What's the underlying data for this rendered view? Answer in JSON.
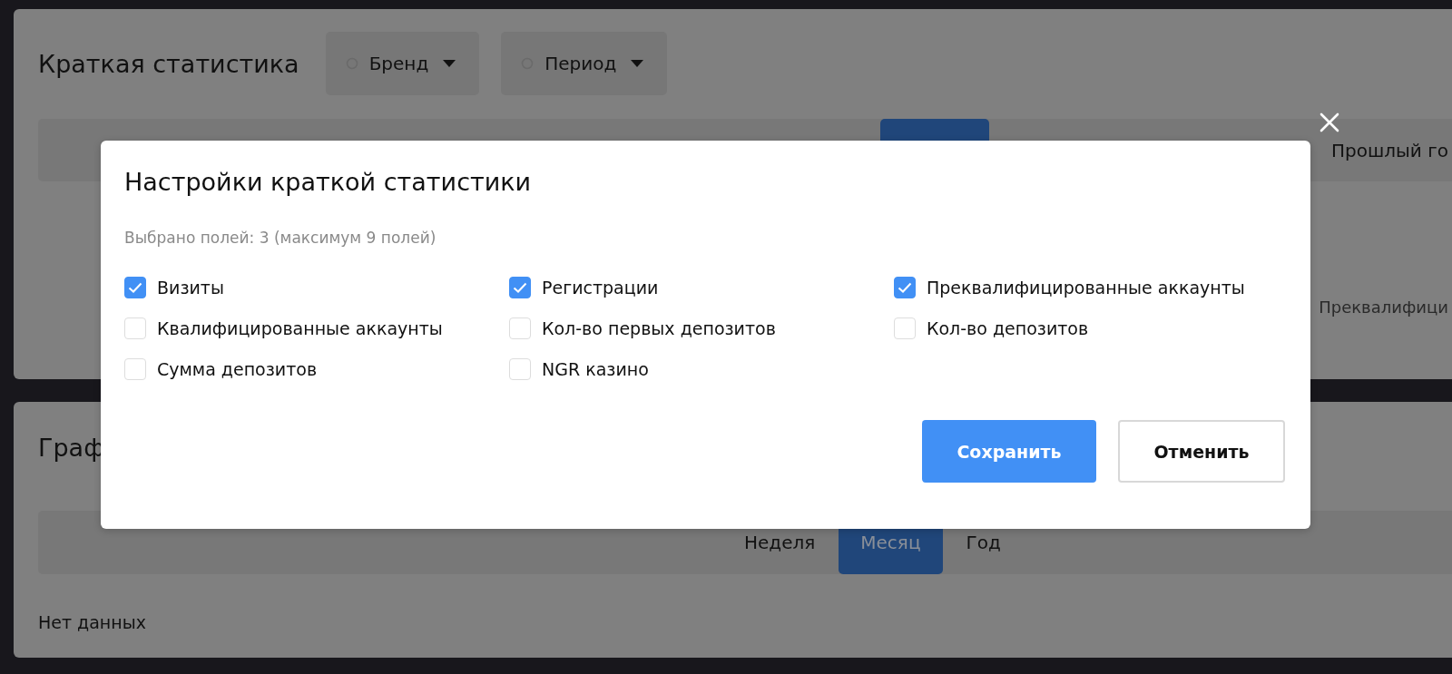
{
  "stats_panel": {
    "title": "Краткая статистика",
    "filters": [
      {
        "label": "Бренд"
      },
      {
        "label": "Период"
      }
    ],
    "tabs": [
      {
        "label": "Прошлый го",
        "selected": false
      }
    ],
    "metric_label": "Преквалифици"
  },
  "chart_panel": {
    "title": "Граф",
    "tabs": [
      {
        "label": "Неделя",
        "selected": false
      },
      {
        "label": "Месяц",
        "selected": true
      },
      {
        "label": "Год",
        "selected": false
      }
    ],
    "empty_text": "Нет данных"
  },
  "dialog": {
    "title": "Настройки краткой статистики",
    "subtitle": "Выбрано полей: 3 (максимум 9 полей)",
    "fields": [
      {
        "label": "Визиты",
        "checked": true
      },
      {
        "label": "Регистрации",
        "checked": true
      },
      {
        "label": "Преквалифицированные аккаунты",
        "checked": true
      },
      {
        "label": "Квалифицированные аккаунты",
        "checked": false
      },
      {
        "label": "Кол-во первых депозитов",
        "checked": false
      },
      {
        "label": "Кол-во депозитов",
        "checked": false
      },
      {
        "label": "Сумма депозитов",
        "checked": false
      },
      {
        "label": "NGR казино",
        "checked": false
      }
    ],
    "buttons": [
      {
        "label": "Сохранить",
        "kind": "primary"
      },
      {
        "label": "Отменить",
        "kind": "secondary"
      }
    ]
  }
}
